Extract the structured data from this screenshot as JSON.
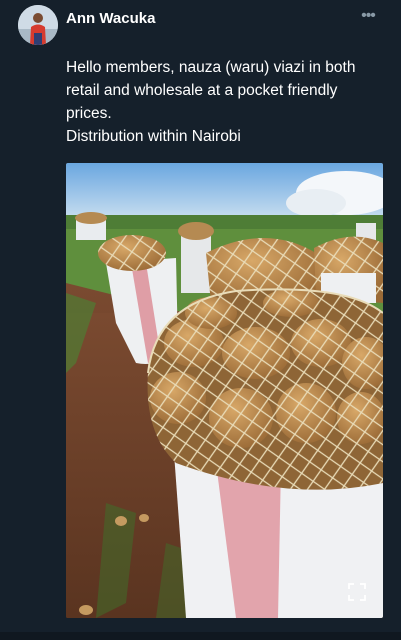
{
  "post": {
    "author_name": "Ann Wacuka",
    "more_icon": "more-horizontal-icon",
    "text_lines": [
      "Hello members, nauza (waru) viazi in both",
      "retail and wholesale at a pocket friendly",
      "prices.",
      "Distribution within Nairobi"
    ],
    "media": {
      "expand_icon": "expand-icon"
    }
  },
  "colors": {
    "background": "#15202b",
    "text": "#ffffff",
    "muted": "#8899a6"
  }
}
